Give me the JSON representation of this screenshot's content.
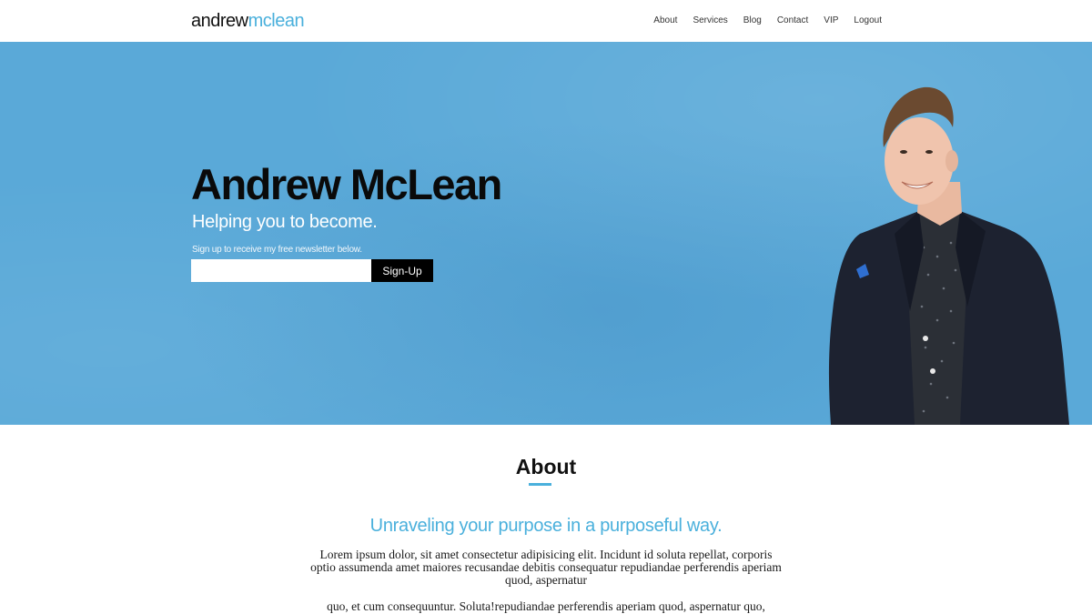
{
  "header": {
    "logo_first": "andrew",
    "logo_second": "mclean",
    "nav": [
      "About",
      "Services",
      "Blog",
      "Contact",
      "VIP",
      "Logout"
    ]
  },
  "hero": {
    "title": "Andrew McLean",
    "subtitle": "Helping you to become.",
    "note": "Sign up to receive my free newsletter below.",
    "email_value": "",
    "signup_label": "Sign-Up"
  },
  "about": {
    "heading": "About",
    "tagline": "Unraveling your purpose in a purposeful way.",
    "paragraph_1": "Lorem ipsum dolor, sit amet consectetur adipisicing elit. Incidunt id soluta repellat, corporis optio assumenda amet maiores recusandae debitis consequatur repudiandae perferendis aperiam quod, aspernatur",
    "paragraph_2": "quo, et cum consequuntur. Soluta!repudiandae perferendis aperiam quod, aspernatur quo,"
  },
  "colors": {
    "accent": "#4ab0dc",
    "hero_background": "#5aa9d8",
    "button_background": "#000000"
  }
}
